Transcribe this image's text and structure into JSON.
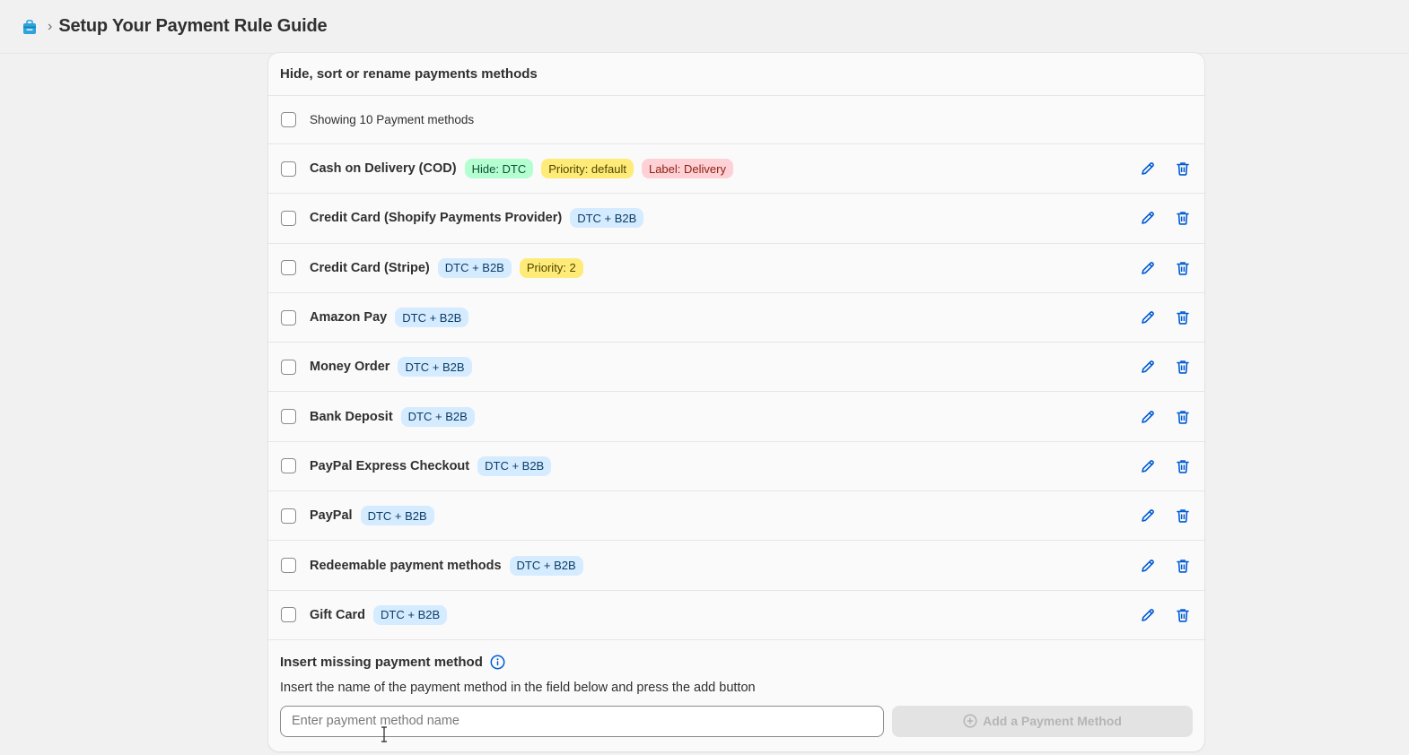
{
  "header": {
    "app_icon": "shopping-bag-icon",
    "breadcrumb_separator": "›",
    "title": "Setup Your Payment Rule Guide"
  },
  "card": {
    "title": "Hide, sort or rename payments methods",
    "summary": "Showing 10 Payment methods",
    "methods": [
      {
        "name": "Cash on Delivery (COD)",
        "badges": [
          {
            "text": "Hide: DTC",
            "tone": "green"
          },
          {
            "text": "Priority: default",
            "tone": "yellow"
          },
          {
            "text": "Label: Delivery",
            "tone": "red"
          }
        ]
      },
      {
        "name": "Credit Card (Shopify Payments Provider)",
        "badges": [
          {
            "text": "DTC + B2B",
            "tone": "blue"
          }
        ]
      },
      {
        "name": "Credit Card (Stripe)",
        "badges": [
          {
            "text": "DTC + B2B",
            "tone": "blue"
          },
          {
            "text": "Priority: 2",
            "tone": "yellow"
          }
        ]
      },
      {
        "name": "Amazon Pay",
        "badges": [
          {
            "text": "DTC + B2B",
            "tone": "blue"
          }
        ]
      },
      {
        "name": "Money Order",
        "badges": [
          {
            "text": "DTC + B2B",
            "tone": "blue"
          }
        ]
      },
      {
        "name": "Bank Deposit",
        "badges": [
          {
            "text": "DTC + B2B",
            "tone": "blue"
          }
        ]
      },
      {
        "name": "PayPal Express Checkout",
        "badges": [
          {
            "text": "DTC + B2B",
            "tone": "blue"
          }
        ]
      },
      {
        "name": "PayPal",
        "badges": [
          {
            "text": "DTC + B2B",
            "tone": "blue"
          }
        ]
      },
      {
        "name": "Redeemable payment methods",
        "badges": [
          {
            "text": "DTC + B2B",
            "tone": "blue"
          }
        ]
      },
      {
        "name": "Gift Card",
        "badges": [
          {
            "text": "DTC + B2B",
            "tone": "blue"
          }
        ]
      }
    ],
    "row_actions": {
      "edit_icon": "pencil-icon",
      "delete_icon": "trash-icon",
      "color": "#005bd3"
    }
  },
  "insert": {
    "title": "Insert missing payment method",
    "info_icon": "info-icon",
    "help_text": "Insert the name of the payment method in the field below and press the add button",
    "input_value": "",
    "input_placeholder": "Enter payment method name",
    "add_button_label": "Add a Payment Method",
    "add_button_icon": "plus-circle-icon",
    "add_button_disabled": true
  },
  "colors": {
    "background": "#f1f1f1",
    "card": "#fafafa",
    "accent": "#005bd3",
    "badge_blue": "#d5ebff",
    "badge_green": "#b4fed2",
    "badge_yellow": "#ffeb78",
    "badge_red": "#fed1d7"
  }
}
